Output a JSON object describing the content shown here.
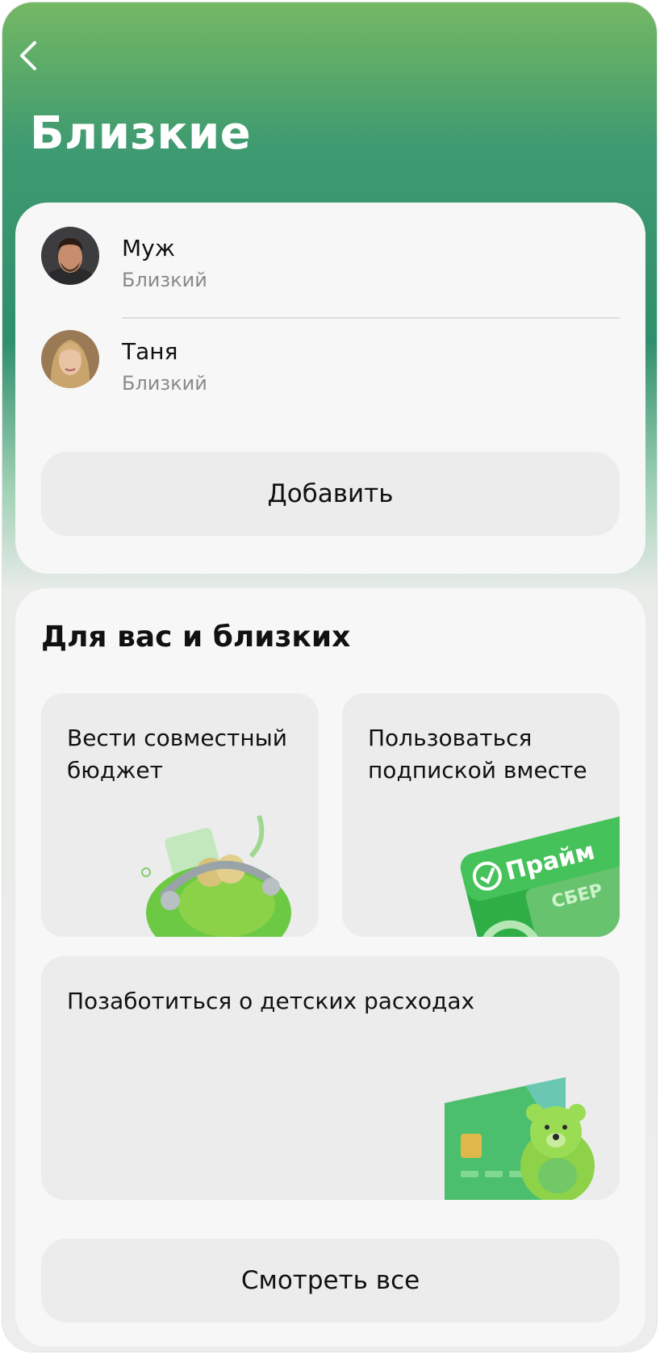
{
  "header": {
    "title": "Близкие"
  },
  "contacts": [
    {
      "name": "Муж",
      "role": "Близкий"
    },
    {
      "name": "Таня",
      "role": "Близкий"
    }
  ],
  "add_button_label": "Добавить",
  "offers": {
    "title": "Для вас и близких",
    "tiles": [
      {
        "label": "Вести совместный бюджет",
        "image": "wallet-with-coins-illustration"
      },
      {
        "label": "Пользоваться подпиской вместе",
        "image": "prime-subscription-card-illustration",
        "card_brand": "Прайм",
        "card_bank": "СБЕР"
      },
      {
        "label": "Позаботиться о детских расходах",
        "image": "kids-card-with-teddy-bear-illustration"
      }
    ],
    "see_all_label": "Смотреть все"
  },
  "colors": {
    "header_gradient_top": "#74b864",
    "header_gradient_mid": "#2f8f6c",
    "card_background": "#f7f7f7",
    "tile_background": "#ececec",
    "accent_green": "#21a038"
  }
}
